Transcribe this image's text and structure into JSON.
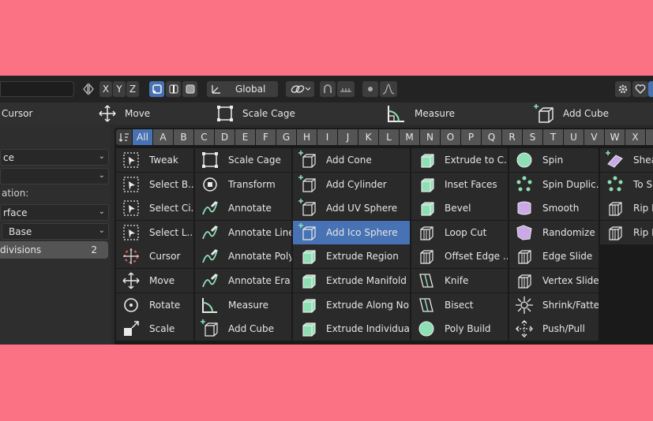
{
  "header": {
    "axes": [
      "X",
      "Y",
      "Z"
    ],
    "orientation": "Global"
  },
  "toolbar": [
    {
      "label": "Cursor",
      "icon": "cursor-icon"
    },
    {
      "label": "Move",
      "icon": "move-icon"
    },
    {
      "label": "Scale Cage",
      "icon": "scale-cage-icon"
    },
    {
      "label": "Measure",
      "icon": "measure-icon"
    },
    {
      "label": "Add Cube",
      "icon": "add-cube-icon"
    }
  ],
  "left_panel": {
    "dd1": "ce",
    "dd2": "",
    "label1": "ation:",
    "dd3": "rface",
    "dd4": "Base",
    "slider_label": "divisions",
    "slider_value": "2"
  },
  "letters": [
    "All",
    "A",
    "B",
    "C",
    "D",
    "E",
    "F",
    "G",
    "H",
    "I",
    "J",
    "K",
    "L",
    "M",
    "N",
    "O",
    "P",
    "Q",
    "R",
    "S",
    "T",
    "U",
    "V",
    "W",
    "X",
    "Y"
  ],
  "selected_letter": "All",
  "columns": [
    [
      "Tweak",
      "Select B...",
      "Select Ci...",
      "Select L...",
      "Cursor",
      "Move",
      "Rotate",
      "Scale"
    ],
    [
      "Scale Cage",
      "Transform",
      "Annotate",
      "Annotate Line",
      "Annotate Poly...",
      "Annotate Era...",
      "Measure",
      "Add Cube"
    ],
    [
      "Add Cone",
      "Add Cylinder",
      "Add UV Sphere",
      "Add Ico Sphere",
      "Extrude Region",
      "Extrude Manifold",
      "Extrude Along Nor...",
      "Extrude Individual"
    ],
    [
      "Extrude to C...",
      "Inset Faces",
      "Bevel",
      "Loop Cut",
      "Offset Edge ...",
      "Knife",
      "Bisect",
      "Poly Build"
    ],
    [
      "Spin",
      "Spin Duplic...",
      "Smooth",
      "Randomize",
      "Edge Slide",
      "Vertex Slide",
      "Shrink/Fatten",
      "Push/Pull"
    ],
    [
      "Shea",
      "To Sp",
      "Rip R",
      "Rip E"
    ]
  ],
  "highlighted_item": "Add Ico Sphere",
  "colors": {
    "accent": "#4772b3",
    "mesh_green": "#8ee0b4",
    "background_pink": "#fb7285"
  }
}
